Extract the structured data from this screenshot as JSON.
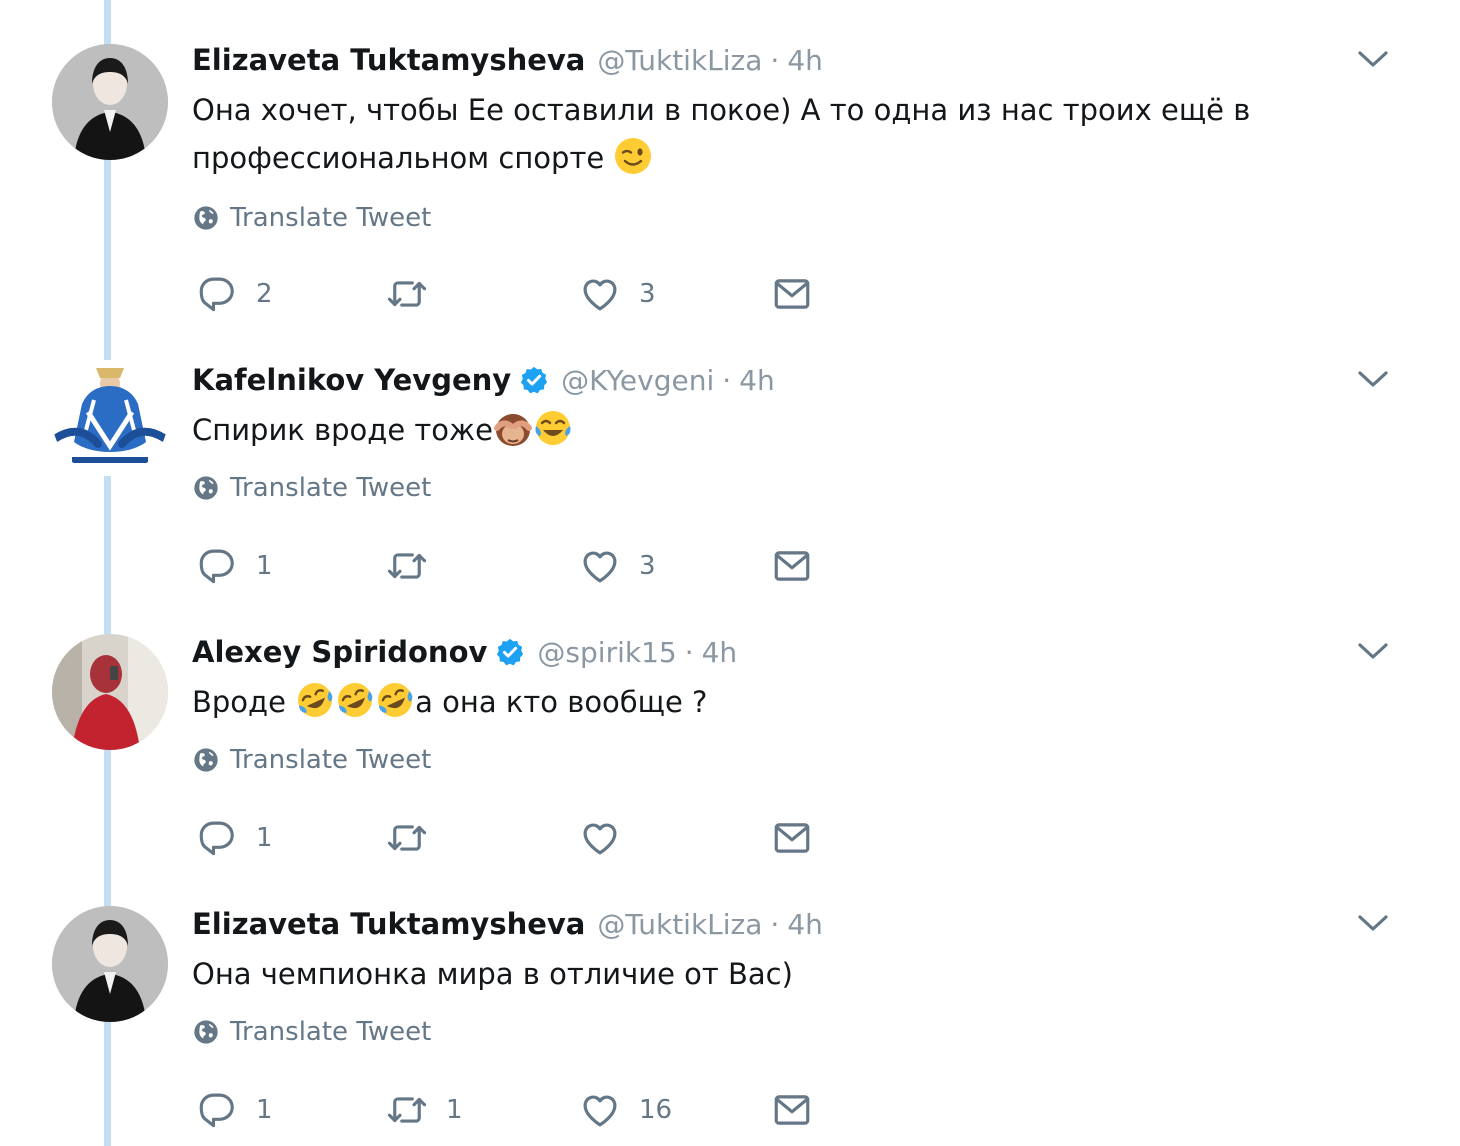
{
  "tweets": [
    {
      "name": "Elizaveta Tuktamysheva",
      "verified": false,
      "handle": "@TuktikLiza",
      "separator": "·",
      "time": "4h",
      "text_parts": [
        "Она хочет, чтобы Ее оставили в покое) А то одна из нас троих ещё в профессиональном спорте"
      ],
      "emojis": [
        "winking-face"
      ],
      "translate_label": "Translate Tweet",
      "replies": "2",
      "retweets": "",
      "likes": "3"
    },
    {
      "name": "Kafelnikov Yevgeny",
      "verified": true,
      "handle": "@KYevgeni",
      "separator": "·",
      "time": "4h",
      "text_parts": [
        "Спирик вроде тоже"
      ],
      "emojis": [
        "see-no-evil-monkey",
        "face-with-tears-of-joy"
      ],
      "translate_label": "Translate Tweet",
      "replies": "1",
      "retweets": "",
      "likes": "3"
    },
    {
      "name": "Alexey Spiridonov",
      "verified": true,
      "handle": "@spirik15",
      "separator": "·",
      "time": "4h",
      "text_parts": [
        "Вроде ",
        "а она кто вообще ?"
      ],
      "emojis": [
        "rolling-on-floor-laughing",
        "rolling-on-floor-laughing",
        "rolling-on-floor-laughing"
      ],
      "translate_label": "Translate Tweet",
      "replies": "1",
      "retweets": "",
      "likes": ""
    },
    {
      "name": "Elizaveta Tuktamysheva",
      "verified": false,
      "handle": "@TuktikLiza",
      "separator": "·",
      "time": "4h",
      "text_parts": [
        "Она чемпионка мира в отличие от Вас)"
      ],
      "emojis": [],
      "translate_label": "Translate Tweet",
      "replies": "1",
      "retweets": "1",
      "likes": "16"
    }
  ],
  "colors": {
    "thread_line": "#c4dff4",
    "verified": "#1da1f2",
    "secondary_text": "#657786",
    "handle_text": "#8b98a3",
    "icon": "#657786"
  }
}
